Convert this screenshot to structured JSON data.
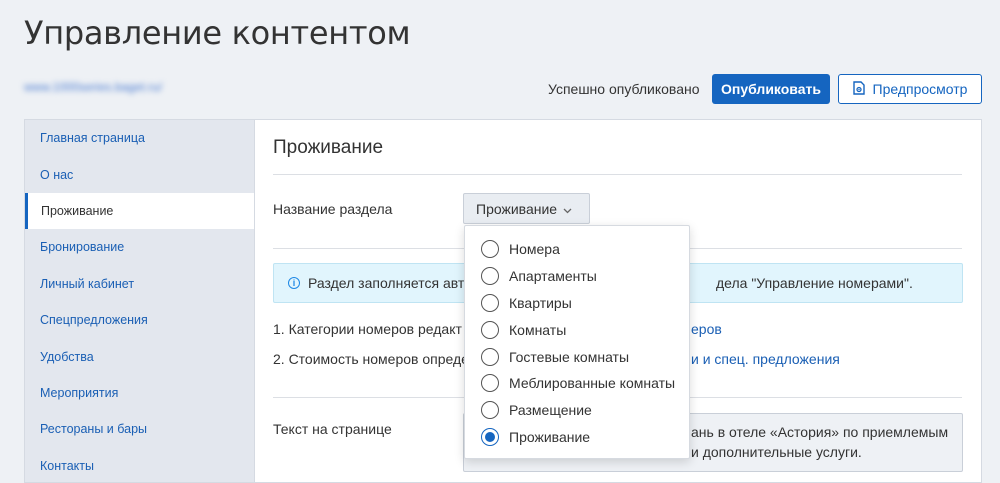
{
  "header": {
    "title": "Управление контентом",
    "site_url": "www.1000series.baget.ru/",
    "status": "Успешно опубликовано",
    "publish_label": "Опубликовать",
    "preview_label": "Предпросмотр"
  },
  "sidebar": {
    "items": [
      {
        "label": "Главная страница"
      },
      {
        "label": "О нас"
      },
      {
        "label": "Проживание"
      },
      {
        "label": "Бронирование"
      },
      {
        "label": "Личный кабинет"
      },
      {
        "label": "Спецпредложения"
      },
      {
        "label": "Удобства"
      },
      {
        "label": "Мероприятия"
      },
      {
        "label": "Рестораны и бары"
      },
      {
        "label": "Контакты"
      }
    ],
    "active_index": 2
  },
  "main": {
    "section_title": "Проживание",
    "name_label": "Название раздела",
    "select_value": "Проживание",
    "info_text_start": "Раздел заполняется авто",
    "info_text_end": "дела \"Управление номерами\".",
    "note1_start": "1. Категории номеров редакт",
    "note1_link": "еров",
    "note2_start": "2. Стоимость номеров опреде",
    "note2_link": "и и спец. предложения",
    "text_label": "Текст на странице",
    "text_line1": "ань в отеле «Астория» по приемлемым",
    "text_line2": "и дополнительные услуги."
  },
  "dropdown": {
    "options": [
      {
        "label": "Номера",
        "checked": false
      },
      {
        "label": "Апартаменты",
        "checked": false
      },
      {
        "label": "Квартиры",
        "checked": false
      },
      {
        "label": "Комнаты",
        "checked": false
      },
      {
        "label": "Гостевые комнаты",
        "checked": false
      },
      {
        "label": "Меблированные комнаты",
        "checked": false
      },
      {
        "label": "Размещение",
        "checked": false
      },
      {
        "label": "Проживание",
        "checked": true
      }
    ]
  },
  "colors": {
    "accent": "#1565c0",
    "link": "#1a5fb4",
    "info_bg": "#e1f5fd",
    "sidebar_bg": "#e3e7ee"
  },
  "icons": {
    "preview": "document-eye-icon",
    "chevron": "chevron-down-icon",
    "info": "info-icon"
  }
}
